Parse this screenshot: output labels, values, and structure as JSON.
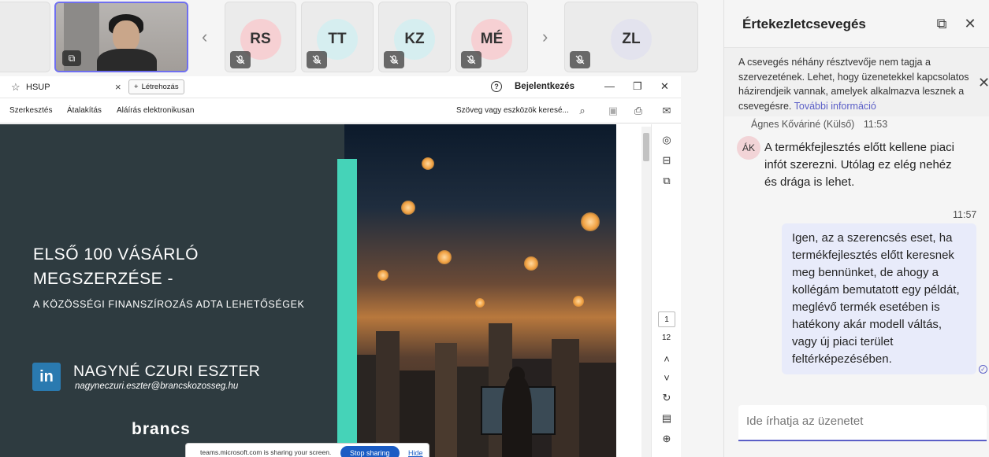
{
  "participants": {
    "tiles": [
      {
        "initials": "RS",
        "color": "#f6d0d3"
      },
      {
        "initials": "TT",
        "color": "#d6eef0"
      },
      {
        "initials": "KZ",
        "color": "#d6eef0"
      },
      {
        "initials": "MÉ",
        "color": "#f6d0d3"
      },
      {
        "initials": "ZL",
        "color": "#e3e3ee"
      }
    ]
  },
  "chat": {
    "title": "Értekezletcsevegés",
    "notice": "A csevegés néhány résztvevője nem tagja a szervezetének. Lehet, hogy üzenetekkel kapcsolatos házirendjeik vannak, amelyek alkalmazva lesznek a csevegésre.",
    "notice_link": "További információ",
    "incoming": {
      "sender": "Ágnes Kőváriné (Külső)",
      "time": "11:53",
      "initials": "ÁK",
      "text": "A termékfejlesztés előtt kellene piaci infót szerezni. Utólag ez elég nehéz és drága is lehet."
    },
    "outgoing": {
      "time": "11:57",
      "text": "Igen, az a szerencsés eset, ha termékfejlesztés előtt keresnek meg bennünket, de ahogy a kollégám bemutatott egy példát, meglévő termék esetében is hatékony akár modell váltás, vagy új piaci terület feltérképezésében."
    },
    "compose_placeholder": "Ide írhatja az üzenetet"
  },
  "app": {
    "tab_name": "HSUP",
    "create_label": "Létrehozás",
    "signin_label": "Bejelentkezés",
    "menu": [
      "Szerkesztés",
      "Átalakítás",
      "Aláírás elektronikusan"
    ],
    "search_label": "Szöveg vagy eszközök keresé...",
    "page_current": "1",
    "page_total": "12"
  },
  "slide": {
    "title_line1": "ELSŐ 100 VÁSÁRLÓ",
    "title_line2": "MEGSZERZÉSE -",
    "subtitle": "A KÖZÖSSÉGI FINANSZÍROZÁS ADTA LEHETŐSÉGEK",
    "author_name": "NAGYNÉ CZURI ESZTER",
    "author_email": "nagyneczuri.eszter@brancskozosseg.hu",
    "brand": "brancs",
    "linkedin_label": "in"
  },
  "share_banner": {
    "text": "teams.microsoft.com is sharing your screen.",
    "stop_label": "Stop sharing",
    "hide_label": "Hide"
  }
}
